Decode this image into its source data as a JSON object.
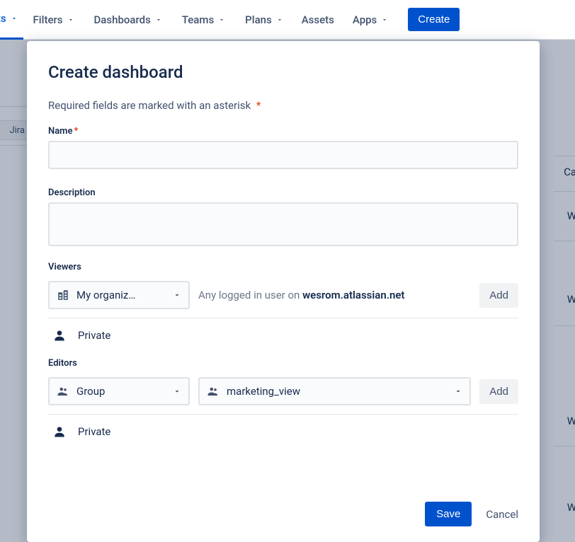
{
  "topnav": {
    "partial_item": "cts",
    "items": [
      "Filters",
      "Dashboards",
      "Teams",
      "Plans",
      "Assets",
      "Apps"
    ],
    "items_has_chevron": [
      true,
      true,
      true,
      true,
      false,
      true
    ],
    "create_label": "Create"
  },
  "bg": {
    "chip": "Jira",
    "right": [
      "Ca",
      "W",
      "W",
      "W",
      "W"
    ]
  },
  "modal": {
    "title": "Create dashboard",
    "required_note": "Required fields are marked with an asterisk",
    "name_label": "Name",
    "name_value": "",
    "desc_label": "Description",
    "desc_value": "",
    "viewers": {
      "label": "Viewers",
      "scope_selected": "My organiz…",
      "help_prefix": "Any logged in user on ",
      "help_domain": "wesrom.atlassian.net",
      "add_label": "Add",
      "private_label": "Private"
    },
    "editors": {
      "label": "Editors",
      "scope_selected": "Group",
      "value_selected": "marketing_view",
      "add_label": "Add",
      "private_label": "Private"
    },
    "save_label": "Save",
    "cancel_label": "Cancel"
  }
}
